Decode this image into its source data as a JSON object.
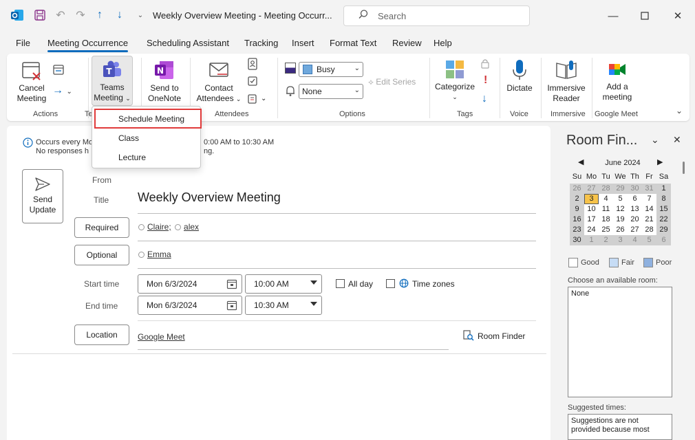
{
  "window": {
    "title": "Weekly Overview Meeting  -  Meeting Occurr...",
    "search_placeholder": "Search"
  },
  "tabs": [
    {
      "label": "File"
    },
    {
      "label": "Meeting Occurrence"
    },
    {
      "label": "Scheduling Assistant"
    },
    {
      "label": "Tracking"
    },
    {
      "label": "Insert"
    },
    {
      "label": "Format Text"
    },
    {
      "label": "Review"
    },
    {
      "label": "Help"
    }
  ],
  "ribbon": {
    "cancel": "Cancel\nMeeting",
    "cancel_l1": "Cancel",
    "cancel_l2": "Meeting",
    "teams_l1": "Teams",
    "teams_l2": "Meeting",
    "onenote_l1": "Send to",
    "onenote_l2": "OneNote",
    "contact_l1": "Contact",
    "contact_l2": "Attendees",
    "busy": "Busy",
    "reminder": "None",
    "edit_series": "Edit Series",
    "categorize": "Categorize",
    "dictate": "Dictate",
    "immersive_l1": "Immersive",
    "immersive_l2": "Reader",
    "addmeet_l1": "Add a",
    "addmeet_l2": "meeting",
    "groups": {
      "actions": "Actions",
      "teams": "Te",
      "attendees": "Attendees",
      "options": "Options",
      "tags": "Tags",
      "voice": "Voice",
      "immersive": "Immersive",
      "google_meet": "Google Meet"
    }
  },
  "dropdown": {
    "items": [
      "Schedule Meeting",
      "Class",
      "Lecture"
    ]
  },
  "form": {
    "info_line1_a": "Occurs every Mo",
    "info_line1_b": "0:00 AM to 10:30 AM",
    "info_line2_a": "No responses h",
    "info_line2_b": "ng.",
    "send_l1": "Send",
    "send_l2": "Update",
    "from_label": "From",
    "title_label": "Title",
    "title_value": "Weekly Overview Meeting",
    "required_btn": "Required",
    "required_people": [
      "Claire;",
      "alex"
    ],
    "optional_btn": "Optional",
    "optional_people": [
      "Emma"
    ],
    "start_label": "Start time",
    "start_date": "Mon 6/3/2024",
    "start_time": "10:00 AM",
    "allday": "All day",
    "timezones": "Time zones",
    "end_label": "End time",
    "end_date": "Mon 6/3/2024",
    "end_time": "10:30 AM",
    "location_btn": "Location",
    "location_value": "Google Meet",
    "room_finder": "Room Finder"
  },
  "room_finder": {
    "title": "Room Fin...",
    "month": "June 2024",
    "weekdays": [
      "Su",
      "Mo",
      "Tu",
      "We",
      "Th",
      "Fr",
      "Sa"
    ],
    "weeks": [
      [
        "26",
        "27",
        "28",
        "29",
        "30",
        "31",
        "1"
      ],
      [
        "2",
        "3",
        "4",
        "5",
        "6",
        "7",
        "8"
      ],
      [
        "9",
        "10",
        "11",
        "12",
        "13",
        "14",
        "15"
      ],
      [
        "16",
        "17",
        "18",
        "19",
        "20",
        "21",
        "22"
      ],
      [
        "23",
        "24",
        "25",
        "26",
        "27",
        "28",
        "29"
      ],
      [
        "30",
        "1",
        "2",
        "3",
        "4",
        "5",
        "6"
      ]
    ],
    "selected_day": "3",
    "legend": [
      "Good",
      "Fair",
      "Poor"
    ],
    "choose_label": "Choose an available room:",
    "rooms": [
      "None"
    ],
    "suggested_label": "Suggested times:",
    "suggested_text": "Suggestions are not provided because most"
  },
  "colors": {
    "accent": "#0f6cbd",
    "highlight": "#e03a3a",
    "selected_day": "#f7c34a",
    "fair": "#c6dcf5",
    "poor": "#8fb1df"
  }
}
